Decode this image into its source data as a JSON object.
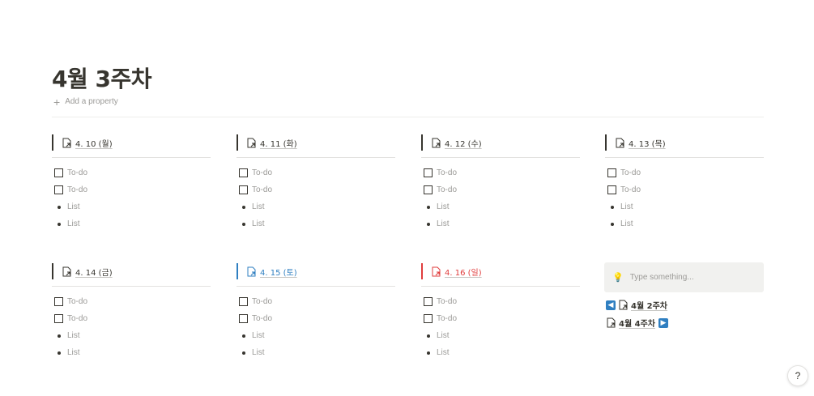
{
  "page": {
    "title": "4월 3주차",
    "add_property": "Add a property"
  },
  "days": [
    {
      "label": "4. 10 (월)",
      "todos": [
        "To-do",
        "To-do"
      ],
      "list": [
        "List",
        "List"
      ]
    },
    {
      "label": "4. 11 (화)",
      "todos": [
        "To-do",
        "To-do"
      ],
      "list": [
        "List",
        "List"
      ]
    },
    {
      "label": "4. 12 (수)",
      "todos": [
        "To-do",
        "To-do"
      ],
      "list": [
        "List",
        "List"
      ]
    },
    {
      "label": "4. 13 (목)",
      "todos": [
        "To-do",
        "To-do"
      ],
      "list": [
        "List",
        "List"
      ]
    },
    {
      "label": "4. 14 (금)",
      "todos": [
        "To-do",
        "To-do"
      ],
      "list": [
        "List",
        "List"
      ]
    },
    {
      "label": "4. 15 (토)",
      "color": "#2f7fc1",
      "todos": [
        "To-do",
        "To-do"
      ],
      "list": [
        "List",
        "List"
      ]
    },
    {
      "label": "4. 16 (일)",
      "color": "#e03e3e",
      "todos": [
        "To-do",
        "To-do"
      ],
      "list": [
        "List",
        "List"
      ]
    }
  ],
  "callout": {
    "icon": "lightbulb-icon",
    "placeholder": "Type something..."
  },
  "nav": {
    "prev_label": "4월 2주차",
    "next_label": "4월 4주차",
    "prev_icon": "arrow-left-icon",
    "next_icon": "arrow-right-icon"
  },
  "help": {
    "label": "?"
  },
  "colors": {
    "text": "#37352f",
    "muted": "#9b9a97",
    "blue": "#2f7fc1",
    "red": "#e03e3e",
    "callout_bg": "#f1f1ef"
  }
}
